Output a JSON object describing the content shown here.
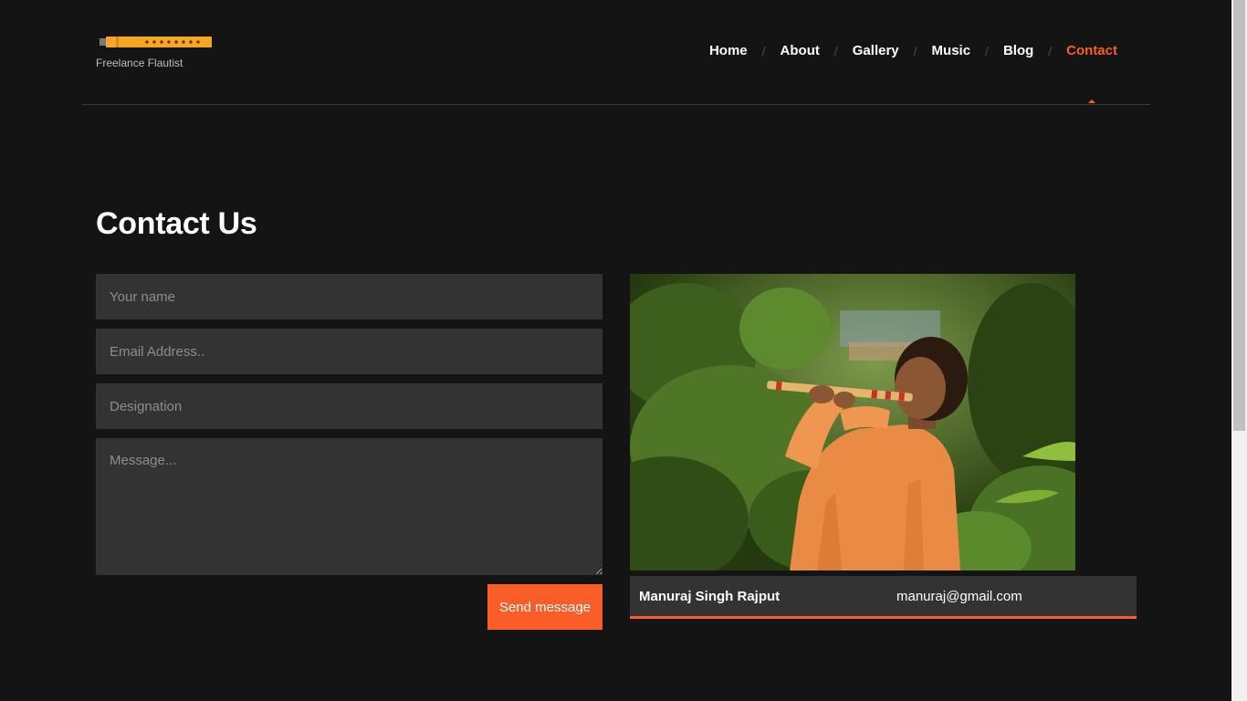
{
  "brand": {
    "tagline": "Freelance Flautist",
    "logo_icon": "flute-icon",
    "logo_color": "#f6a623"
  },
  "nav": {
    "items": [
      {
        "label": "Home"
      },
      {
        "label": "About"
      },
      {
        "label": "Gallery"
      },
      {
        "label": "Music"
      },
      {
        "label": "Blog"
      },
      {
        "label": "Contact"
      }
    ],
    "separator": "/",
    "active_index": 5
  },
  "page": {
    "title": "Contact Us"
  },
  "form": {
    "name_placeholder": "Your name",
    "email_placeholder": "Email Address..",
    "designation_placeholder": "Designation",
    "message_placeholder": "Message...",
    "submit_label": "Send message"
  },
  "contact": {
    "name": "Manuraj Singh Rajput",
    "email": "manuraj@gmail.com"
  },
  "colors": {
    "accent": "#fa5d27",
    "background": "#141414",
    "field_background": "#333333"
  }
}
